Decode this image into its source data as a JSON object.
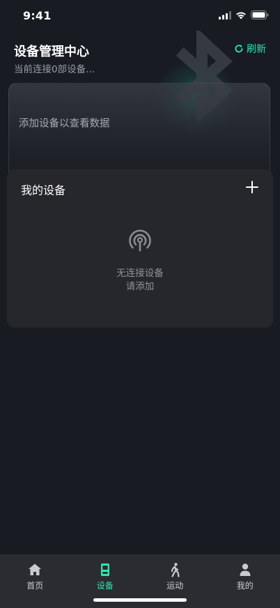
{
  "status_bar": {
    "time": "9:41"
  },
  "header": {
    "title": "设备管理中心",
    "subtitle": "当前连接0部设备...",
    "refresh_label": "刷新"
  },
  "data_card": {
    "hint": "添加设备以查看数据"
  },
  "devices": {
    "title": "我的设备",
    "empty_line1": "无连接设备",
    "empty_line2": "请添加"
  },
  "tabs": [
    {
      "label": "首页",
      "icon": "home-icon",
      "active": false
    },
    {
      "label": "设备",
      "icon": "device-icon",
      "active": true
    },
    {
      "label": "运动",
      "icon": "walking-icon",
      "active": false
    },
    {
      "label": "我的",
      "icon": "user-icon",
      "active": false
    }
  ],
  "colors": {
    "background": "#181b22",
    "accent": "#2ee6b0",
    "card": "#26272d",
    "tab_bar": "#2b2c32",
    "muted_text": "#9a9ea7"
  }
}
